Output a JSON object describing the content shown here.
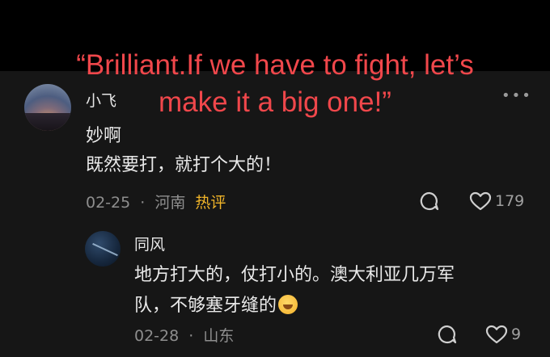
{
  "overlay_caption": "“Brilliant.If we have to fight, let’s\nmake it a big one!”",
  "comment": {
    "username": "小飞",
    "text_line1": "妙啊",
    "text_line2": "既然要打，就打个大的！",
    "date": "02-25",
    "location": "河南",
    "hot_tag": "热评",
    "like_count": "179"
  },
  "reply": {
    "username": "同风",
    "text_line1": "地方打大的，仗打小的。澳大利亚几万军",
    "text_line2": "队，不够塞牙缝的",
    "date": "02-28",
    "location": "山东",
    "like_count": "9"
  },
  "separator": "·",
  "more_glyph": "•••",
  "icons": {
    "reply": "chat-bubble-icon",
    "like": "heart-icon",
    "more": "more-options-icon",
    "emoji": "rofl-emoji-icon"
  }
}
